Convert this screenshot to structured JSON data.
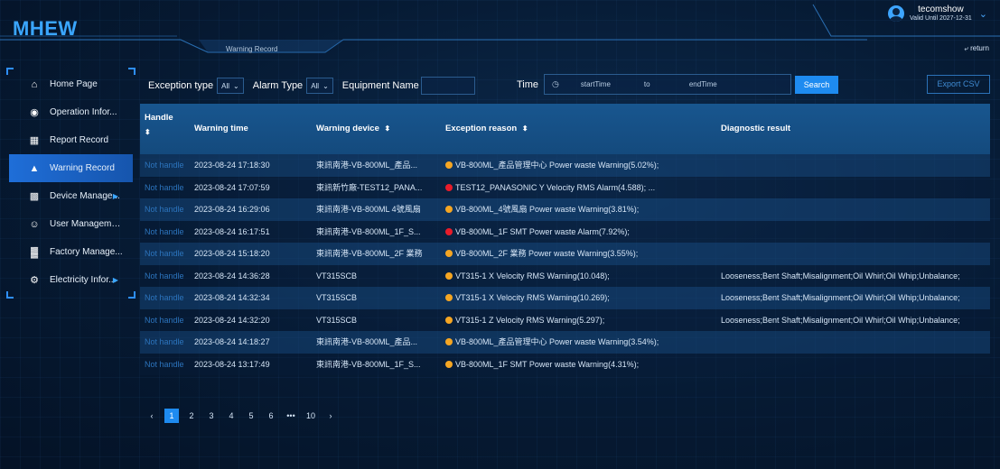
{
  "app": {
    "logo": "MHEW",
    "subtitle_tab": "Warning Record"
  },
  "user": {
    "name": "tecomshow",
    "valid": "Valid Until 2027-12-31"
  },
  "return_label": "return",
  "sidebar": {
    "items": [
      {
        "label": "Home Page",
        "icon": "home-icon",
        "glyph": "⌂"
      },
      {
        "label": "Operation Infor...",
        "icon": "operation-icon",
        "glyph": "◉"
      },
      {
        "label": "Report Record",
        "icon": "report-icon",
        "glyph": "▦"
      },
      {
        "label": "Warning Record",
        "icon": "bell-icon",
        "glyph": "▲"
      },
      {
        "label": "Device Manage...",
        "icon": "device-icon",
        "glyph": "▩"
      },
      {
        "label": "User Management",
        "icon": "users-icon",
        "glyph": "☺"
      },
      {
        "label": "Factory Manage...",
        "icon": "factory-icon",
        "glyph": "▓"
      },
      {
        "label": "Electricity Infor...",
        "icon": "gear-icon",
        "glyph": "⚙"
      }
    ],
    "active_index": 3
  },
  "filters": {
    "exception_type_label": "Exception type",
    "exception_type_value": "All",
    "alarm_type_label": "Alarm Type",
    "alarm_type_value": "All",
    "equipment_name_label": "Equipment Name",
    "time_label": "Time",
    "start_placeholder": "startTime",
    "to_label": "to",
    "end_placeholder": "endTime",
    "search_label": "Search",
    "export_label": "Export CSV"
  },
  "table": {
    "headers": {
      "handle": "Handle",
      "warning_time": "Warning time",
      "warning_device": "Warning device",
      "exception_reason": "Exception reason",
      "diagnostic_result": "Diagnostic result"
    },
    "sort_glyph": "⬍",
    "rows": [
      {
        "status": "Not handle",
        "time": "2023-08-24 17:18:30",
        "device": "東訊南港-VB-800ML_產品...",
        "dot": "#f5a623",
        "reason": "VB-800ML_產品管理中心 Power waste Warning(5.02%);",
        "diagnostic": ""
      },
      {
        "status": "Not handle",
        "time": "2023-08-24 17:07:59",
        "device": "東訊新竹廠-TEST12_PANA...",
        "dot": "#e81c2a",
        "reason": "TEST12_PANASONIC Y Velocity RMS Alarm(4.588); ...",
        "diagnostic": ""
      },
      {
        "status": "Not handle",
        "time": "2023-08-24 16:29:06",
        "device": "東訊南港-VB-800ML 4號風扇",
        "dot": "#f5a623",
        "reason": "VB-800ML_4號風扇 Power waste Warning(3.81%);",
        "diagnostic": ""
      },
      {
        "status": "Not handle",
        "time": "2023-08-24 16:17:51",
        "device": "東訊南港-VB-800ML_1F_S...",
        "dot": "#e81c2a",
        "reason": "VB-800ML_1F SMT Power waste Alarm(7.92%);",
        "diagnostic": ""
      },
      {
        "status": "Not handle",
        "time": "2023-08-24 15:18:20",
        "device": "東訊南港-VB-800ML_2F 業務",
        "dot": "#f5a623",
        "reason": "VB-800ML_2F 業務 Power waste Warning(3.55%);",
        "diagnostic": ""
      },
      {
        "status": "Not handle",
        "time": "2023-08-24 14:36:28",
        "device": "VT315SCB",
        "dot": "#f5a623",
        "reason": "VT315-1 X Velocity RMS Warning(10.048);",
        "diagnostic": "Looseness;Bent Shaft;Misalignment;Oil Whirl;Oil Whip;Unbalance;"
      },
      {
        "status": "Not handle",
        "time": "2023-08-24 14:32:34",
        "device": "VT315SCB",
        "dot": "#f5a623",
        "reason": "VT315-1 X Velocity RMS Warning(10.269);",
        "diagnostic": "Looseness;Bent Shaft;Misalignment;Oil Whirl;Oil Whip;Unbalance;"
      },
      {
        "status": "Not handle",
        "time": "2023-08-24 14:32:20",
        "device": "VT315SCB",
        "dot": "#f5a623",
        "reason": "VT315-1 Z Velocity RMS Warning(5.297);",
        "diagnostic": "Looseness;Bent Shaft;Misalignment;Oil Whirl;Oil Whip;Unbalance;"
      },
      {
        "status": "Not handle",
        "time": "2023-08-24 14:18:27",
        "device": "東訊南港-VB-800ML_產品...",
        "dot": "#f5a623",
        "reason": "VB-800ML_產品管理中心 Power waste Warning(3.54%);",
        "diagnostic": ""
      },
      {
        "status": "Not handle",
        "time": "2023-08-24 13:17:49",
        "device": "東訊南港-VB-800ML_1F_S...",
        "dot": "#f5a623",
        "reason": "VB-800ML_1F SMT Power waste Warning(4.31%);",
        "diagnostic": ""
      }
    ]
  },
  "pagination": {
    "prev": "‹",
    "pages": [
      "1",
      "2",
      "3",
      "4",
      "5",
      "6",
      "•••",
      "10"
    ],
    "next": "›",
    "active": "1"
  },
  "colors": {
    "accent": "#1e8bf0",
    "warning": "#f5a623",
    "alarm": "#e81c2a",
    "brand": "#3aa6ff"
  }
}
